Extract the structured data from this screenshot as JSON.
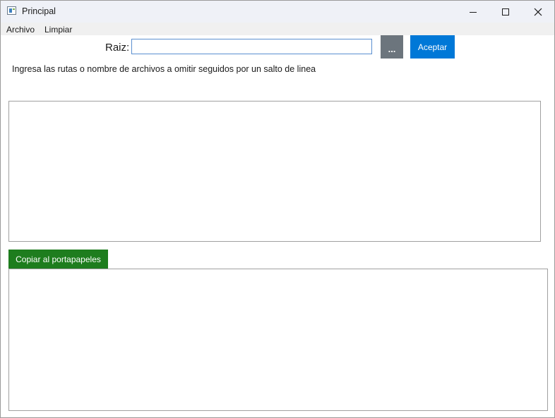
{
  "window": {
    "title": "Principal",
    "controls": {
      "minimize": "minimize-icon",
      "maximize": "maximize-icon",
      "close": "close-icon"
    }
  },
  "menu": {
    "items": [
      {
        "label": "Archivo"
      },
      {
        "label": "Limpiar"
      }
    ]
  },
  "root": {
    "label": "Raiz:",
    "value": "",
    "placeholder": ""
  },
  "buttons": {
    "browse": "...",
    "accept": "Aceptar",
    "copy": "Copiar al portapapeles"
  },
  "instructions": "Ingresa las rutas o nombre de archivos a omitir seguidos por un salto de linea",
  "omit_list": {
    "value": ""
  },
  "output": {
    "value": ""
  },
  "colors": {
    "accept_button": "#0078d7",
    "browse_button": "#6c757d",
    "copy_button": "#1e7d1e",
    "titlebar": "#eff1f7",
    "menubar": "#f0f0f0"
  }
}
